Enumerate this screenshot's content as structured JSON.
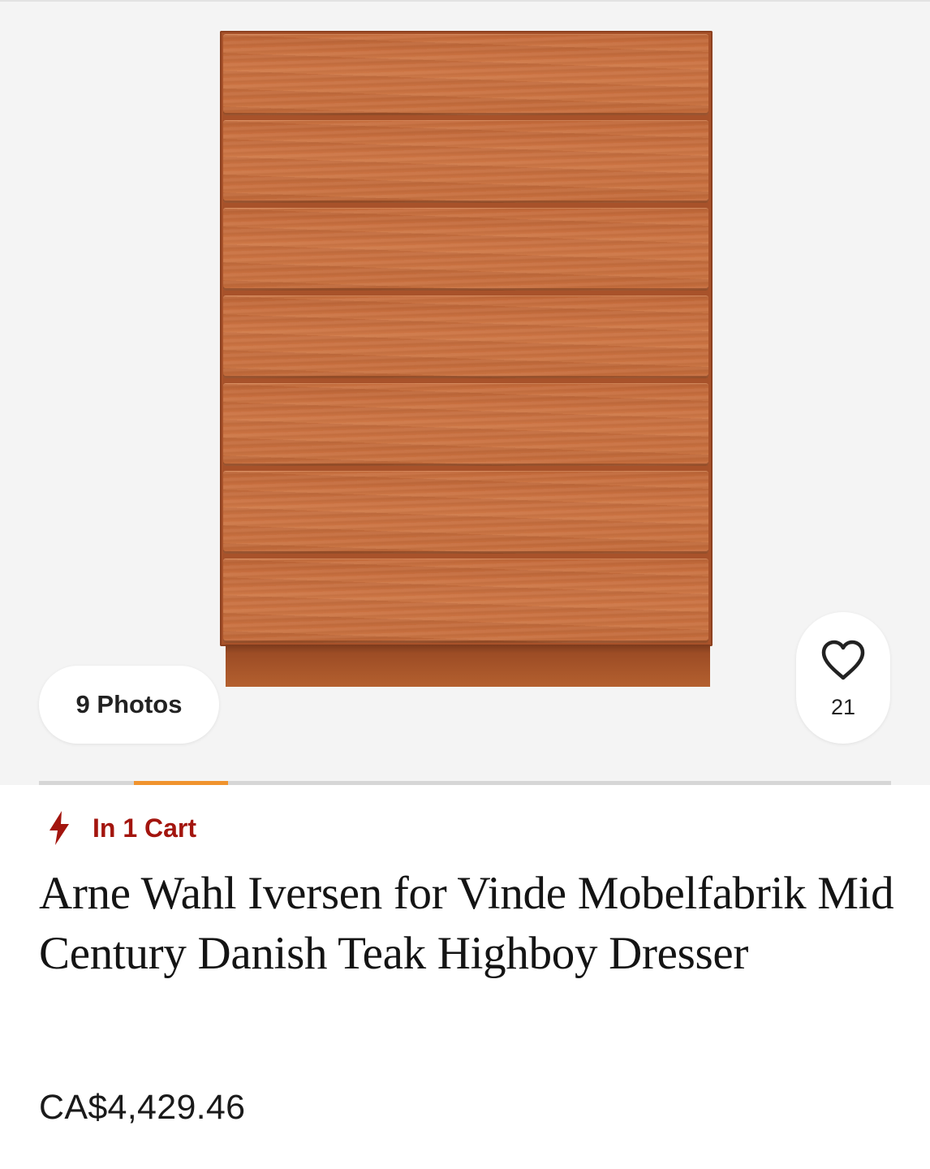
{
  "gallery": {
    "photos_label": "9 Photos",
    "favorites_count": "21",
    "progress": {
      "current_index": 2,
      "total": 9
    }
  },
  "listing": {
    "cart_status": "In 1 Cart",
    "title": "Arne Wahl Iversen for Vinde Mobelfabrik Mid Century Danish Teak Highboy Dresser",
    "price": "CA$4,429.46"
  },
  "icons": {
    "cart_status_icon": "lightning-bolt-icon",
    "favorite_icon": "heart-outline-icon"
  },
  "colors": {
    "accent": "#f0932e",
    "alert": "#a3150e",
    "background": "#f4f4f4"
  }
}
